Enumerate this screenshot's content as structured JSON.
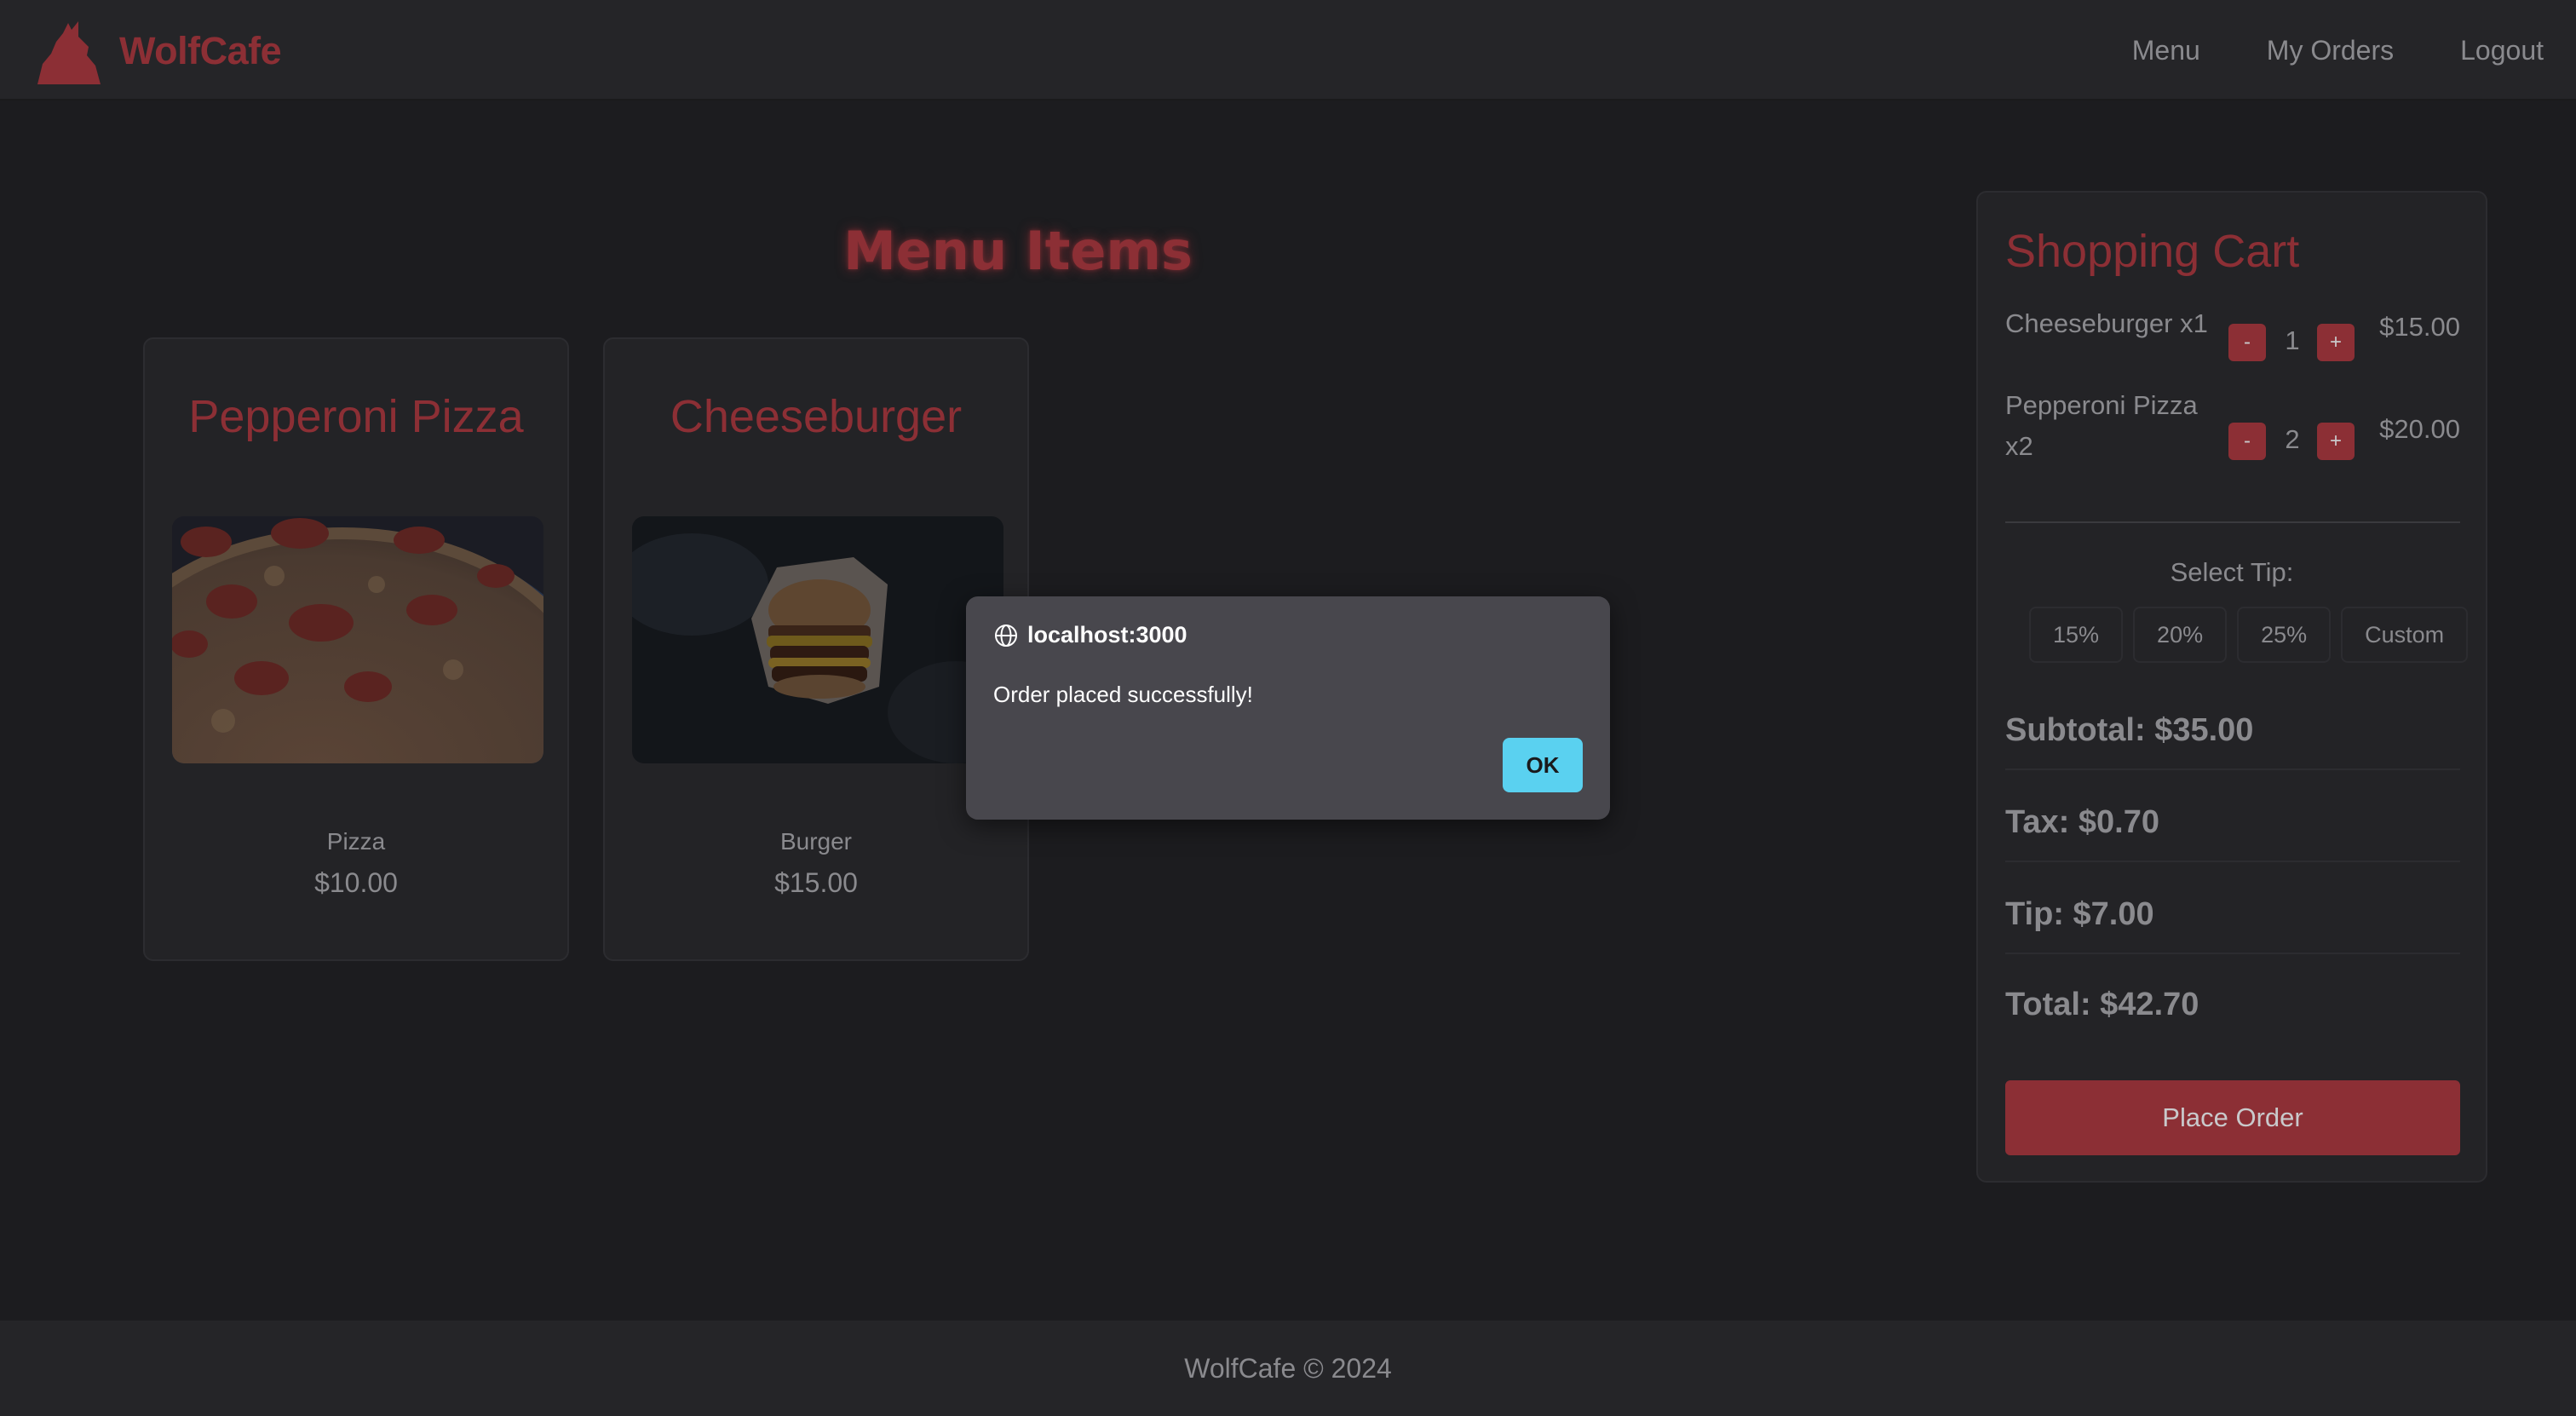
{
  "navbar": {
    "brand_name": "WolfCafe",
    "links": [
      {
        "label": "Menu"
      },
      {
        "label": "My Orders"
      },
      {
        "label": "Logout"
      }
    ]
  },
  "main": {
    "title": "Menu Items",
    "items": [
      {
        "name": "Pepperoni Pizza",
        "category": "Pizza",
        "price": "$10.00",
        "image_icon": "pizza-photo"
      },
      {
        "name": "Cheeseburger",
        "category": "Burger",
        "price": "$15.00",
        "image_icon": "burger-photo"
      }
    ]
  },
  "cart": {
    "title": "Shopping Cart",
    "items": [
      {
        "name": "Cheeseburger x1",
        "minus": "-",
        "qty": "1",
        "plus": "+",
        "total": "$15.00"
      },
      {
        "name": "Pepperoni Pizza x2",
        "minus": "-",
        "qty": "2",
        "plus": "+",
        "total": "$20.00"
      }
    ],
    "tip_label": "Select Tip:",
    "tip_options": [
      "15%",
      "20%",
      "25%",
      "Custom"
    ],
    "subtotal": "Subtotal: $35.00",
    "tax": "Tax: $0.70",
    "tip": "Tip: $7.00",
    "total": "Total: $42.70",
    "place_order": "Place Order"
  },
  "footer": {
    "text": "WolfCafe © 2024"
  },
  "dialog": {
    "origin": "localhost:3000",
    "message": "Order placed successfully!",
    "ok": "OK"
  },
  "colors": {
    "accent": "#8c2f35",
    "background": "#1c1c1f",
    "dialog_bg": "#48474d",
    "ok_button": "#5ad1f0"
  }
}
